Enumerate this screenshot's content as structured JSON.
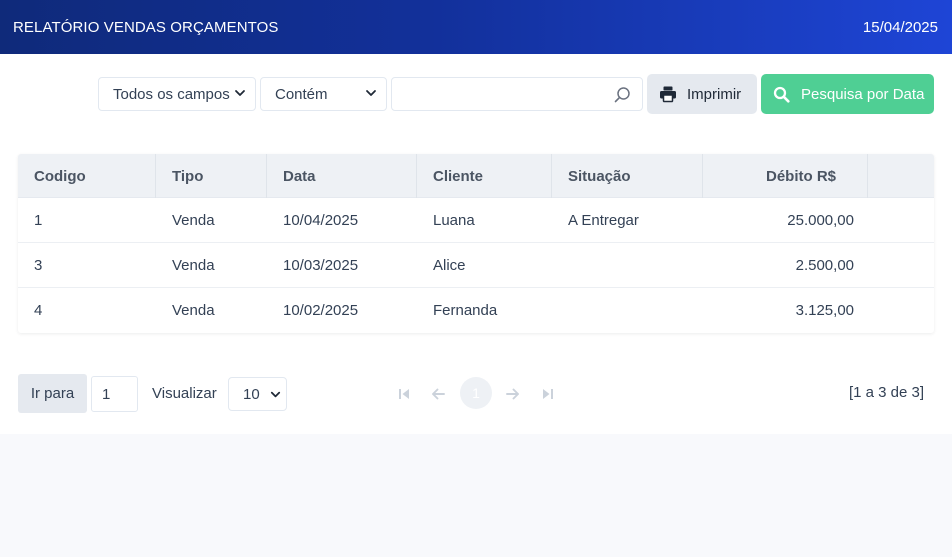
{
  "header": {
    "title": "RELATÓRIO VENDAS ORÇAMENTOS",
    "date": "15/04/2025"
  },
  "toolbar": {
    "field_select": "Todos os campos",
    "operator_select": "Contém",
    "search_value": "",
    "print_label": "Imprimir",
    "date_search_label": "Pesquisa por Data"
  },
  "table": {
    "columns": [
      "Codigo",
      "Tipo",
      "Data",
      "Cliente",
      "Situação",
      "Débito R$",
      ""
    ],
    "rows": [
      {
        "codigo": "1",
        "tipo": "Venda",
        "data": "10/04/2025",
        "cliente": "Luana",
        "situacao": "A Entregar",
        "debito": "25.000,00"
      },
      {
        "codigo": "3",
        "tipo": "Venda",
        "data": "10/03/2025",
        "cliente": "Alice",
        "situacao": "",
        "debito": "2.500,00"
      },
      {
        "codigo": "4",
        "tipo": "Venda",
        "data": "10/02/2025",
        "cliente": "Fernanda",
        "situacao": "",
        "debito": "3.125,00"
      }
    ]
  },
  "pagination": {
    "go_to_label": "Ir para",
    "page_input_value": "1",
    "view_label": "Visualizar",
    "rows_per_page": "10",
    "current_page": "1",
    "summary": "[1 a 3 de 3]"
  },
  "colors": {
    "header_gradient_start": "#0f2a7a",
    "header_gradient_end": "#1e45d6",
    "date_button": "#4fcf94",
    "print_button": "#e5e9ef"
  }
}
